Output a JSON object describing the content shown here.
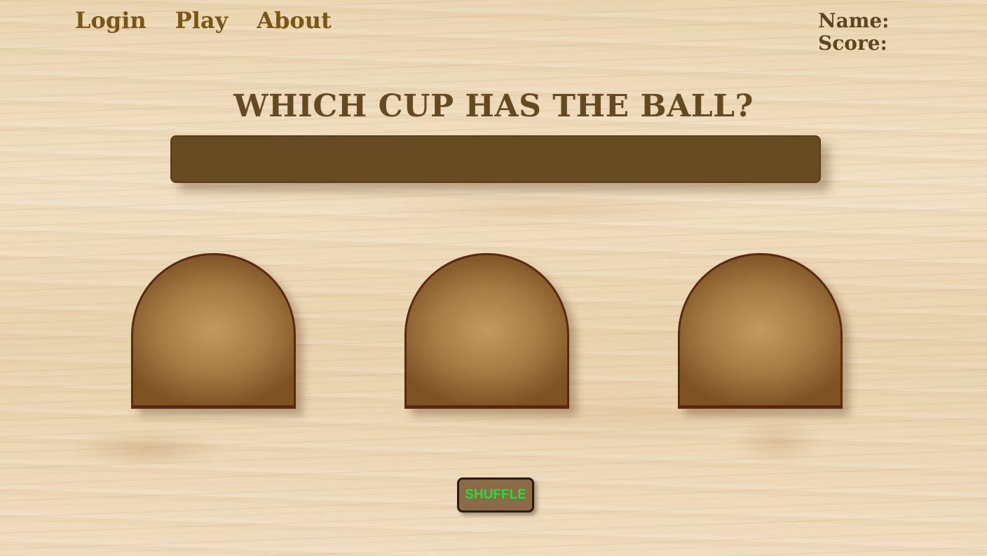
{
  "nav": {
    "links": [
      {
        "label": "Login"
      },
      {
        "label": "Play"
      },
      {
        "label": "About"
      }
    ]
  },
  "player": {
    "name_label": "Name:",
    "score_label": "Score:"
  },
  "game": {
    "title": "WHICH CUP HAS THE BALL?",
    "message": "",
    "cups": 3,
    "shuffle_label": "SHUFFLE"
  },
  "colors": {
    "nav_text": "#7a5514",
    "title_text": "#654920",
    "message_bar": "#664a22",
    "cup_border": "#5a2a10",
    "shuffle_text": "#22e03a",
    "shuffle_bg": "#8b6a46"
  }
}
